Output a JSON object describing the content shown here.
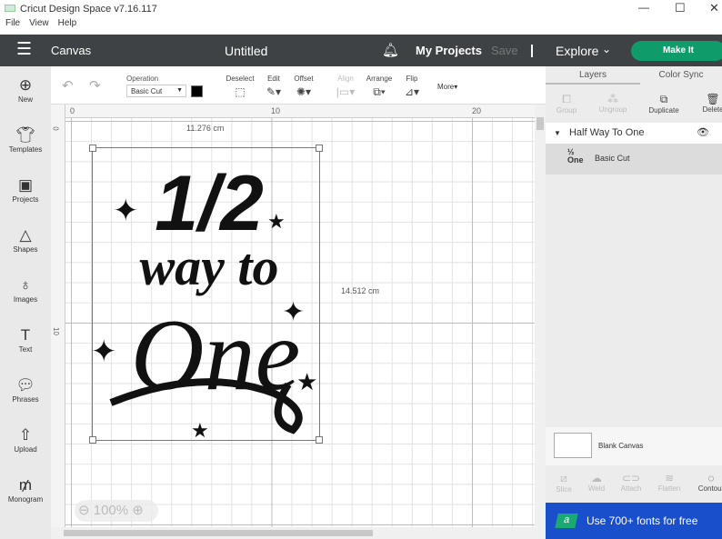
{
  "window": {
    "title": "Cricut Design Space  v7.16.117",
    "logo": "cricut"
  },
  "menu": [
    "File",
    "View",
    "Help"
  ],
  "header": {
    "section": "Canvas",
    "project_title": "Untitled",
    "my_projects": "My Projects",
    "save": "Save",
    "explore": "Explore",
    "make_it": "Make It"
  },
  "toolbar": {
    "operation_label": "Operation",
    "operation_value": "Basic Cut",
    "deselect": "Deselect",
    "edit": "Edit",
    "offset": "Offset",
    "align": "Align",
    "arrange": "Arrange",
    "flip": "Flip",
    "more": "More",
    "color": "#000000"
  },
  "sidebar": [
    {
      "label": "New"
    },
    {
      "label": "Templates"
    },
    {
      "label": "Projects"
    },
    {
      "label": "Shapes"
    },
    {
      "label": "Images"
    },
    {
      "label": "Text"
    },
    {
      "label": "Phrases"
    },
    {
      "label": "Upload"
    },
    {
      "label": "Monogram"
    }
  ],
  "rulers": {
    "top": [
      "0",
      "10",
      "20"
    ],
    "left": [
      "0",
      "10"
    ]
  },
  "design": {
    "width_label": "11.276 cm",
    "height_label": "14.512 cm",
    "line1": "1/2",
    "line2": "way to",
    "line3": "One"
  },
  "zoom": {
    "level": "100%"
  },
  "panel": {
    "tabs": [
      "Layers",
      "Color Sync"
    ],
    "tools": [
      "Group",
      "Ungroup",
      "Duplicate",
      "Delete"
    ],
    "group_name": "Half Way To One",
    "layer_name": "Basic Cut",
    "blank_canvas": "Blank Canvas",
    "bottom_tools": [
      "Slice",
      "Weld",
      "Attach",
      "Flatten",
      "Contour"
    ],
    "banner": "Use 700+ fonts for free",
    "banner_icon": "a"
  }
}
